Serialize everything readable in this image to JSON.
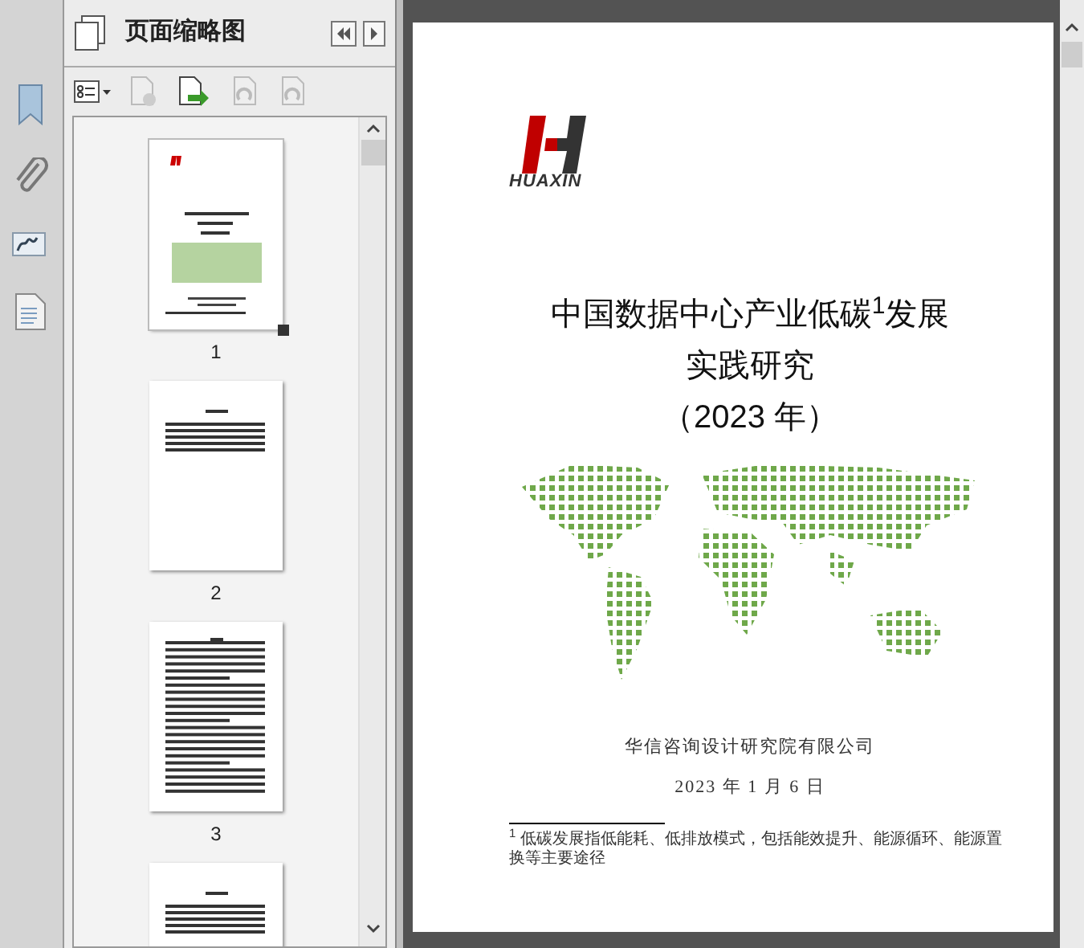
{
  "panel": {
    "title": "页面缩略图"
  },
  "thumbnails": [
    {
      "page_number": "1",
      "selected": true,
      "kind": "cover"
    },
    {
      "page_number": "2",
      "selected": false,
      "kind": "short"
    },
    {
      "page_number": "3",
      "selected": false,
      "kind": "full"
    },
    {
      "selected": false,
      "kind": "short"
    }
  ],
  "page": {
    "logo_text": "HUAXIN",
    "title_lines": [
      "中国数据中心产业低碳$^{1}$发展",
      "实践研究",
      "（2023 年）"
    ],
    "company": "华信咨询设计研究院有限公司",
    "date": "2023 年 1 月 6 日",
    "footnote": "$^{1}$ 低碳发展指低能耗、低排放模式，包括能效提升、能源循环、能源置换等主要途径"
  }
}
